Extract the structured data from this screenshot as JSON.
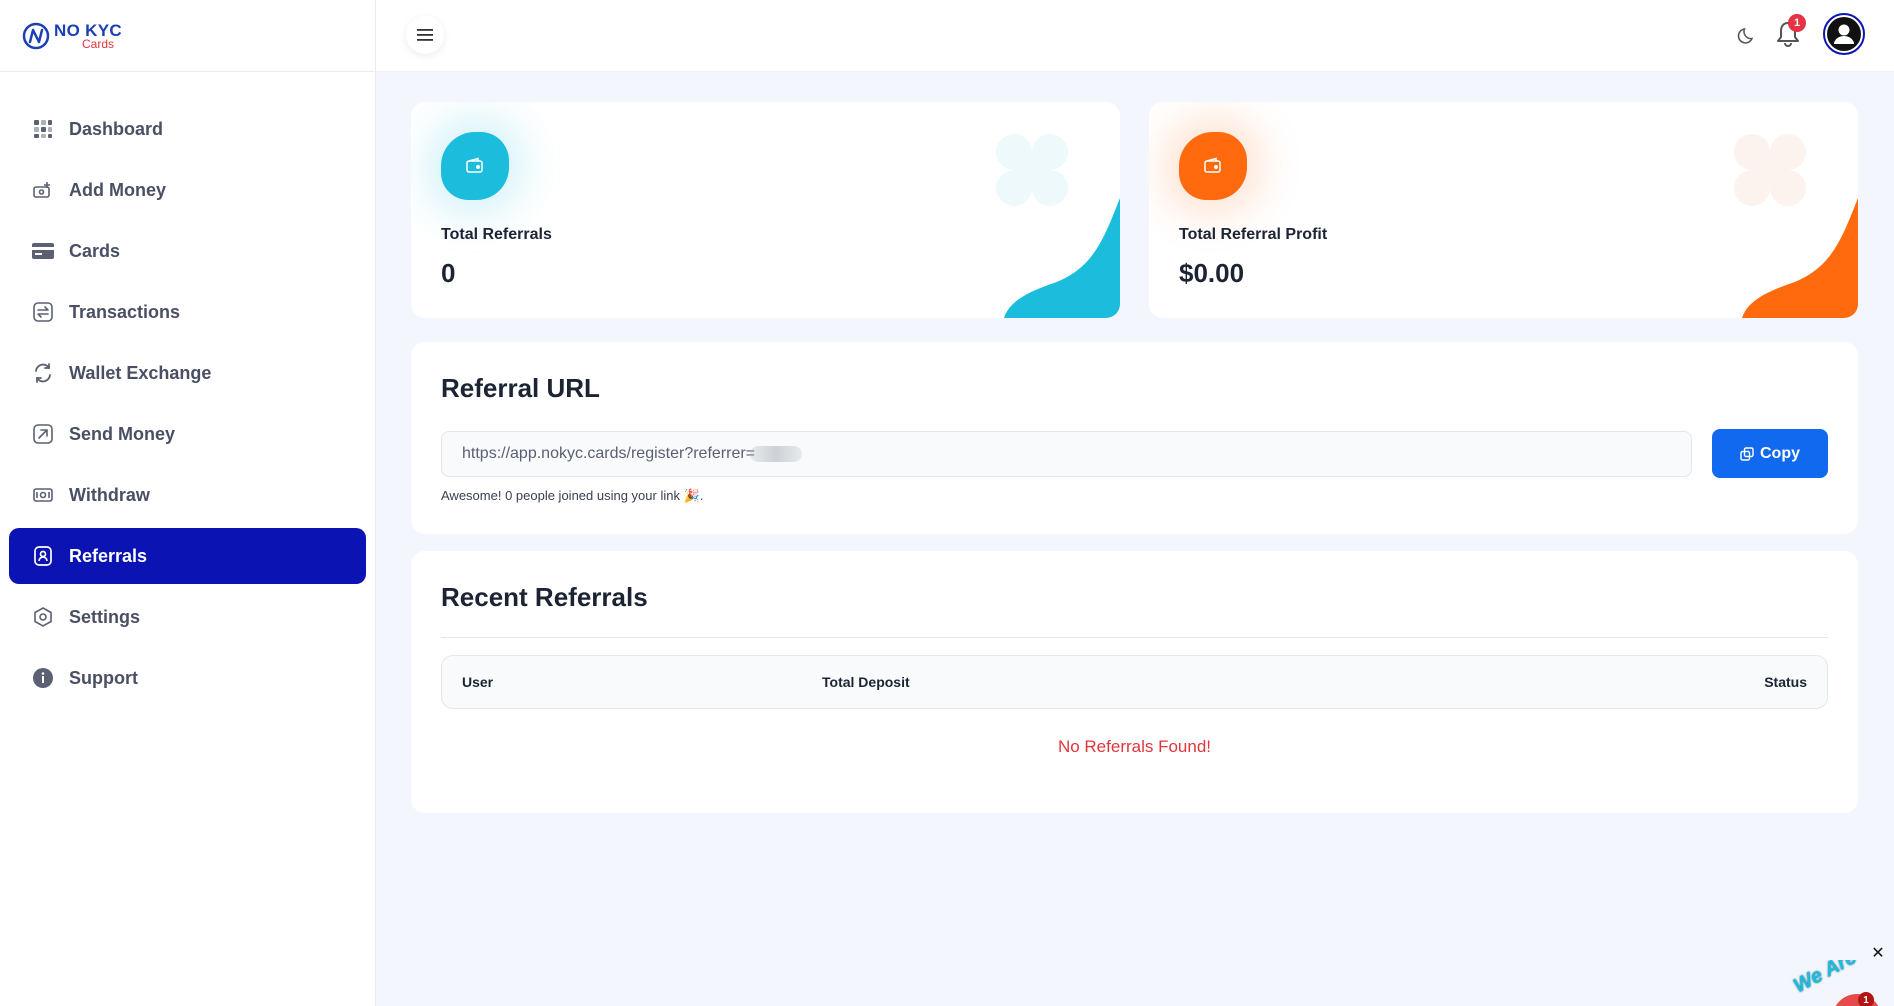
{
  "brand": {
    "title": "NO KYC",
    "subtitle": "Cards"
  },
  "sidebar": {
    "items": [
      {
        "label": "Dashboard",
        "icon": "dashboard-grid-icon"
      },
      {
        "label": "Add Money",
        "icon": "add-money-icon"
      },
      {
        "label": "Cards",
        "icon": "credit-card-icon"
      },
      {
        "label": "Transactions",
        "icon": "transactions-icon"
      },
      {
        "label": "Wallet Exchange",
        "icon": "exchange-icon"
      },
      {
        "label": "Send Money",
        "icon": "send-money-icon"
      },
      {
        "label": "Withdraw",
        "icon": "withdraw-icon"
      },
      {
        "label": "Referrals",
        "icon": "referrals-icon",
        "active": true
      },
      {
        "label": "Settings",
        "icon": "settings-icon"
      },
      {
        "label": "Support",
        "icon": "support-info-icon"
      }
    ]
  },
  "topbar": {
    "notification_count": "1"
  },
  "stats": [
    {
      "label": "Total Referrals",
      "value": "0",
      "accent": "#1bbcdc"
    },
    {
      "label": "Total Referral Profit",
      "value": "$0.00",
      "accent": "#ff6a0e"
    }
  ],
  "referral_url": {
    "title": "Referral URL",
    "value": "https://app.nokyc.cards/register?referrer=",
    "copy_label": "Copy",
    "note": "Awesome! 0 people joined using your link 🎉."
  },
  "recent_referrals": {
    "title": "Recent Referrals",
    "columns": [
      "User",
      "Total Deposit",
      "Status"
    ],
    "empty_message": "No Referrals Found!"
  },
  "widget": {
    "text": "We Are Here!",
    "badge": "1"
  },
  "colors": {
    "primary": "#0b13b3",
    "button": "#1169f0",
    "cyan": "#1bbcdc",
    "orange": "#ff6a0e",
    "danger": "#e0353d"
  }
}
